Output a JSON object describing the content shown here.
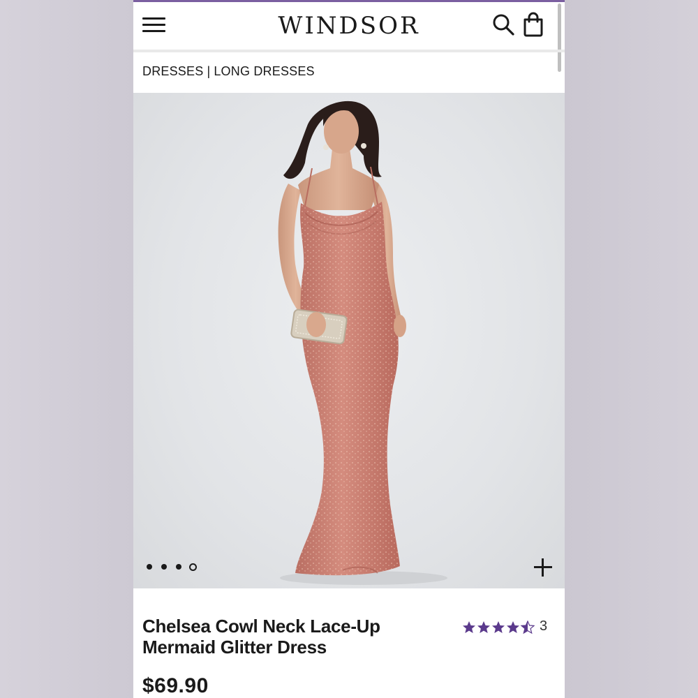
{
  "header": {
    "logo": "WINDSOR",
    "icons": [
      "menu-icon",
      "search-icon",
      "shopping-bag-icon"
    ]
  },
  "breadcrumb": {
    "items": [
      "DRESSES",
      "LONG DRESSES"
    ],
    "separator": "|"
  },
  "gallery": {
    "image_count": 4,
    "active_index": 3,
    "expand_icon": "plus-icon"
  },
  "product": {
    "title_line1": "Chelsea Cowl Neck Lace-Up",
    "title_line2": "Mermaid Glitter Dress",
    "rating": 4.5,
    "rating_max": 5,
    "review_count": "3",
    "price": "$69.90"
  },
  "colors": {
    "accent_purple": "#5b3a8c",
    "dress": "#c97f72",
    "text": "#1a1a1a"
  }
}
